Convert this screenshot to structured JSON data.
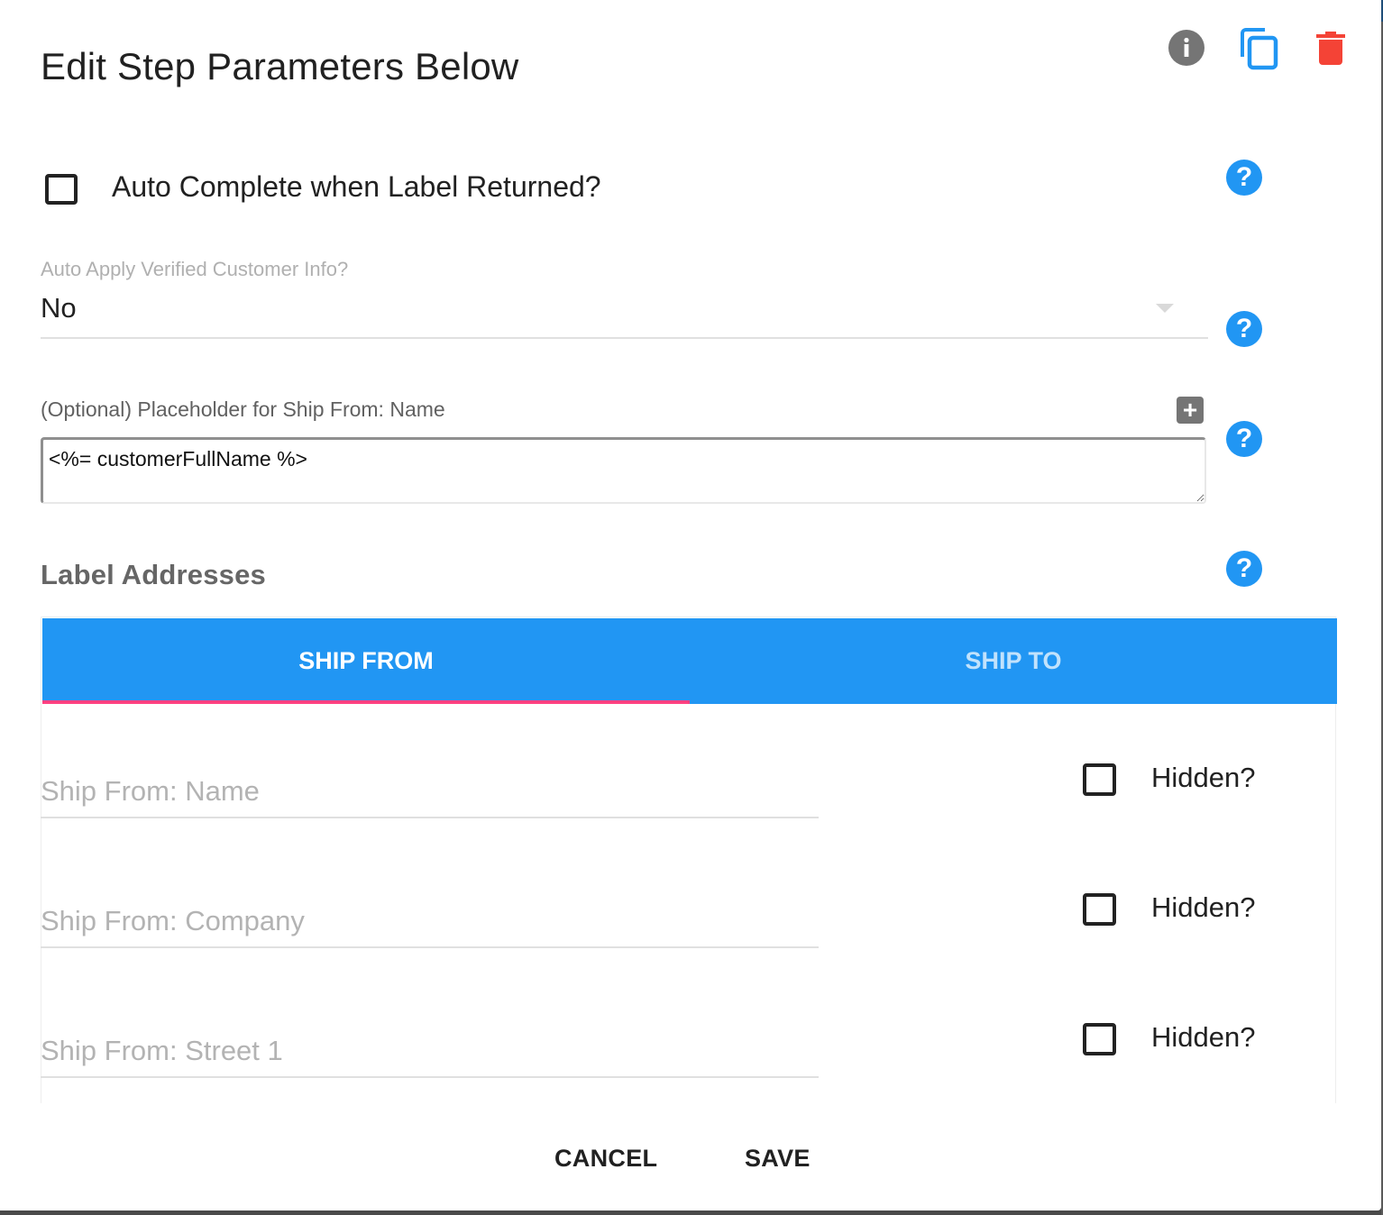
{
  "dialog": {
    "title": "Edit Step Parameters Below",
    "header_icons": [
      {
        "name": "info-icon",
        "color": "#757575"
      },
      {
        "name": "copy-icon",
        "color": "#2196f3"
      },
      {
        "name": "delete-icon",
        "color": "#f44336"
      }
    ]
  },
  "auto_complete": {
    "label": "Auto Complete when Label Returned?",
    "checked": false
  },
  "auto_apply": {
    "label": "Auto Apply Verified Customer Info?",
    "value": "No"
  },
  "placeholder_field": {
    "label": "(Optional) Placeholder for Ship From: Name",
    "add_glyph": "+",
    "value": "<%= customerFullName %>"
  },
  "help_glyph": "?",
  "label_addresses": {
    "title": "Label Addresses",
    "tabs": [
      {
        "label": "SHIP FROM",
        "active": true
      },
      {
        "label": "SHIP TO",
        "active": false
      }
    ],
    "fields": [
      {
        "placeholder": "Ship From: Name",
        "hidden_label": "Hidden?",
        "hidden_checked": false
      },
      {
        "placeholder": "Ship From: Company",
        "hidden_label": "Hidden?",
        "hidden_checked": false
      },
      {
        "placeholder": "Ship From: Street 1",
        "hidden_label": "Hidden?",
        "hidden_checked": false
      }
    ]
  },
  "footer": {
    "cancel_label": "CANCEL",
    "save_label": "SAVE"
  },
  "colors": {
    "primary": "#2196f3",
    "accent": "#ff4081",
    "danger": "#f44336",
    "neutral_icon": "#757575"
  }
}
